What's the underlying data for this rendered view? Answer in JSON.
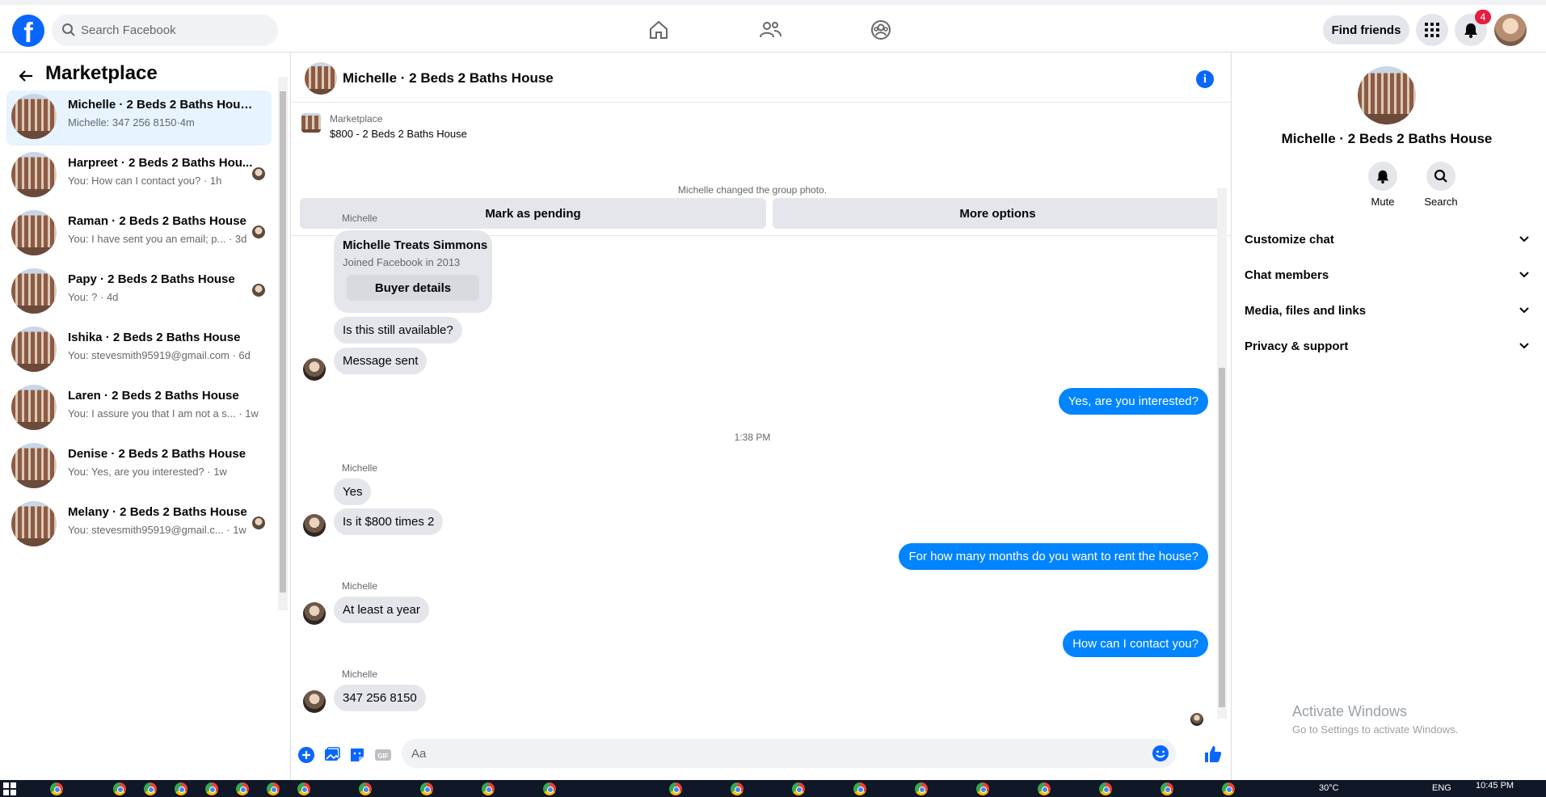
{
  "topbar": {
    "search_placeholder": "Search Facebook",
    "find_friends": "Find friends",
    "notification_count": "4"
  },
  "sidebar": {
    "title": "Marketplace",
    "conversations": [
      {
        "name": "Michelle · 2 Beds 2 Baths House",
        "preview": "Michelle: 347 256 8150·4m",
        "active": true
      },
      {
        "name": "Harpreet · 2 Beds 2 Baths Hou...",
        "preview": "You: How can I contact you? · 1h"
      },
      {
        "name": "Raman · 2 Beds 2 Baths House",
        "preview": "You: I have sent you an email; p... · 3d"
      },
      {
        "name": "Papy · 2 Beds 2 Baths House",
        "preview": "You: ? · 4d"
      },
      {
        "name": "Ishika · 2 Beds 2 Baths House",
        "preview": "You: stevesmith95919@gmail.com · 6d"
      },
      {
        "name": "Laren · 2 Beds 2 Baths House",
        "preview": "You: I assure you that I am not a s... · 1w"
      },
      {
        "name": "Denise · 2 Beds 2 Baths House",
        "preview": "You: Yes, are you interested? · 1w"
      },
      {
        "name": "Melany · 2 Beds 2 Baths House",
        "preview": "You: stevesmith95919@gmail.c... · 1w"
      }
    ]
  },
  "chat": {
    "title": "Michelle · 2 Beds 2 Baths House",
    "marketplace_label": "Marketplace",
    "listing": "$800 - 2 Beds 2 Baths House",
    "mark_pending": "Mark as pending",
    "more_options": "More options",
    "system_msg": "Michelle changed the group photo.",
    "sender": "Michelle",
    "card_name": "Michelle Treats Simmons",
    "card_joined": "Joined Facebook in 2013",
    "buyer_details": "Buyer details",
    "msg1": "Is this still available?",
    "msg2": "Message sent",
    "out1": "Yes, are you interested?",
    "time": "1:38 PM",
    "msg3": "Yes",
    "msg4": "Is it $800 times 2",
    "out2": "For how many months do you want to rent the house?",
    "msg5": "At least a year",
    "out3": "How can I contact you?",
    "msg6": "347 256 8150",
    "composer_placeholder": "Aa"
  },
  "details": {
    "name": "Michelle · 2 Beds 2 Baths House",
    "mute": "Mute",
    "search": "Search",
    "sections": [
      "Customize chat",
      "Chat members",
      "Media, files and links",
      "Privacy & support"
    ],
    "activate_title": "Activate Windows",
    "activate_sub": "Go to Settings to activate Windows."
  },
  "taskbar": {
    "weather": "30°C",
    "lang": "ENG",
    "clock": "10:45 PM"
  },
  "colors": {
    "brand": "#0866ff",
    "outgoing": "#0084ff",
    "incoming": "#e4e6eb"
  }
}
